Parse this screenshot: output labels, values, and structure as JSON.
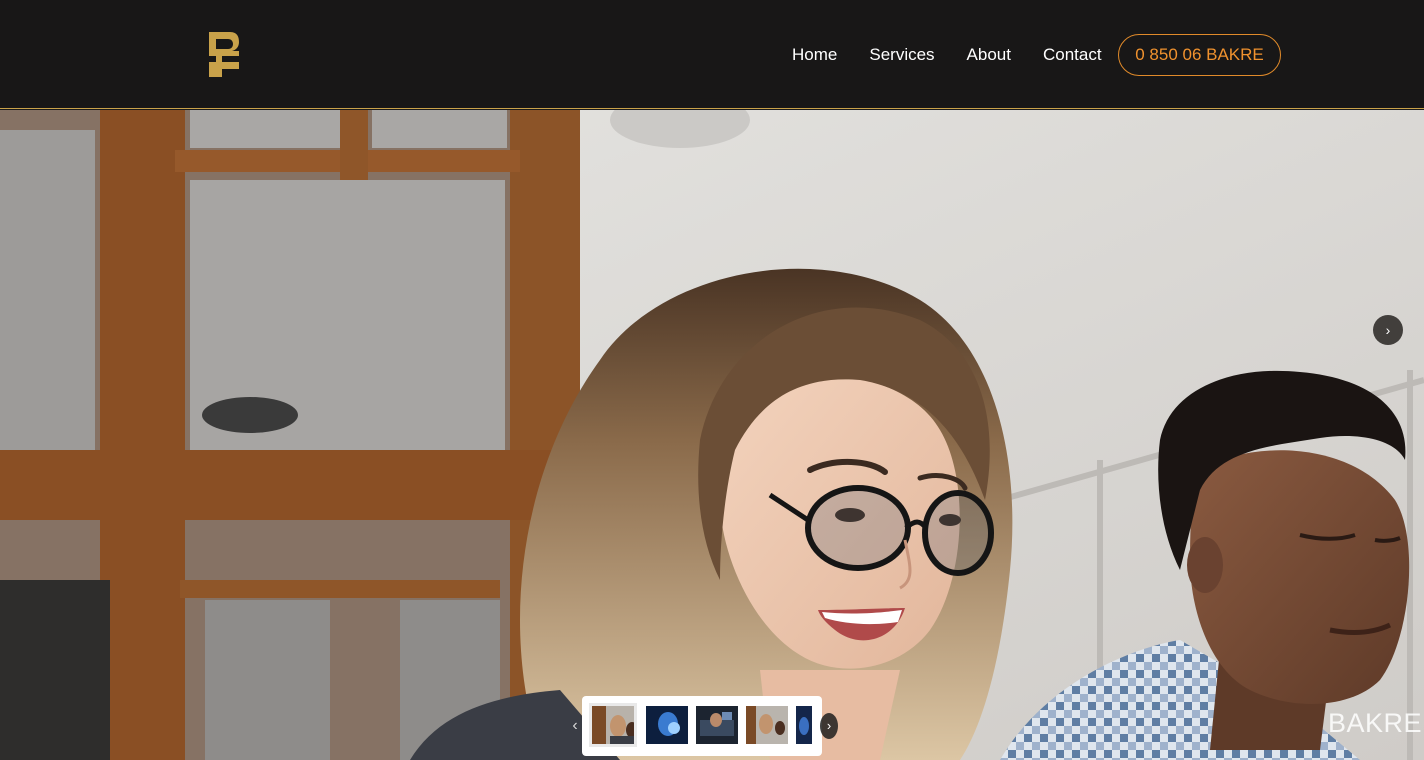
{
  "header": {
    "logo_icon": "re-monogram-logo",
    "nav": [
      "Home",
      "Services",
      "About",
      "Contact"
    ],
    "phone_label": "0 850 06 BAKRE"
  },
  "slider": {
    "next_icon": "chevron-right-icon",
    "prev_icon": "chevron-left-icon",
    "next_symbol": "›",
    "prev_symbol": "‹",
    "thumbnail_count": 5,
    "active_thumbnail": 1
  },
  "watermark": "BAKRE",
  "colors": {
    "header_bg": "#181717",
    "accent_orange": "#e08a2a",
    "logo_gold": "#c9a24a"
  }
}
